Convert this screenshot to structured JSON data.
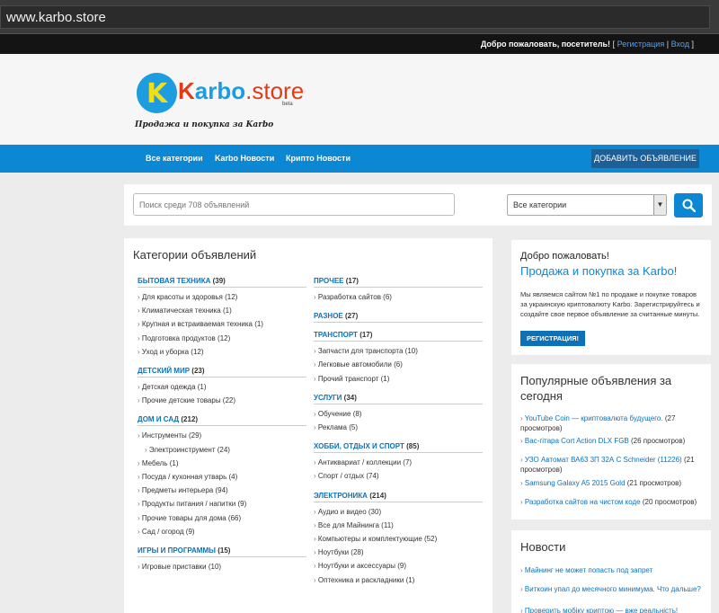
{
  "browser": {
    "url": "www.karbo.store"
  },
  "topbar": {
    "welcome": "Добро пожаловать, посетитель!",
    "open": "[",
    "register": "Регистрация",
    "sep": "|",
    "login": "Вход",
    "close": "]"
  },
  "brand": {
    "logo_letter": "K",
    "name_a": "K",
    "name_b": "arbo",
    "name_c": ".store",
    "beta": "beta",
    "tagline": "Продажа и покупка за Karbo"
  },
  "nav": {
    "items": [
      "Все категории",
      "Karbo Новости",
      "Крипто Новости"
    ],
    "add_button": "ДОБАВИТЬ ОБЪЯВЛЕНИЕ"
  },
  "search": {
    "placeholder": "Поиск среди 708 объявлений",
    "category_value": "Все категории"
  },
  "categories": {
    "title": "Категории объявлений",
    "left": [
      {
        "name": "БЫТОВАЯ ТЕХНИКА",
        "count": "(39)",
        "subs": [
          {
            "t": "Для красоты и здоровья (12)"
          },
          {
            "t": "Климатическая техника (1)"
          },
          {
            "t": "Крупная и встраиваемая техника (1)"
          },
          {
            "t": "Подготовка продуктов (12)"
          },
          {
            "t": "Уход и уборка (12)"
          }
        ]
      },
      {
        "name": "ДЕТСКИЙ МИР",
        "count": "(23)",
        "subs": [
          {
            "t": "Детская одежда (1)"
          },
          {
            "t": "Прочие детские товары (22)"
          }
        ]
      },
      {
        "name": "ДОМ И САД",
        "count": "(212)",
        "subs": [
          {
            "t": "Инструменты (29)"
          },
          {
            "t": "Электроинструмент (24)",
            "indent": true
          },
          {
            "t": "Мебель (1)"
          },
          {
            "t": "Посуда / кухонная утварь (4)"
          },
          {
            "t": "Предметы интерьера (94)"
          },
          {
            "t": "Продукты питания / напитки (9)"
          },
          {
            "t": "Прочие товары для дома (66)"
          },
          {
            "t": "Сад / огород (9)"
          }
        ]
      },
      {
        "name": "ИГРЫ И ПРОГРАММЫ",
        "count": "(15)",
        "subs": [
          {
            "t": "Игровые приставки (10)"
          }
        ]
      }
    ],
    "right": [
      {
        "name": "ПРОЧЕЕ",
        "count": "(17)",
        "subs": [
          {
            "t": "Разработка сайтов (6)"
          }
        ]
      },
      {
        "name": "РАЗНОЕ",
        "count": "(27)",
        "subs": []
      },
      {
        "name": "ТРАНСПОРТ",
        "count": "(17)",
        "subs": [
          {
            "t": "Запчасти для транспорта (10)"
          },
          {
            "t": "Легковые автомобили (6)"
          },
          {
            "t": "Прочий транспорт (1)"
          }
        ]
      },
      {
        "name": "УСЛУГИ",
        "count": "(34)",
        "subs": [
          {
            "t": "Обучение (8)"
          },
          {
            "t": "Реклама (5)"
          }
        ]
      },
      {
        "name": "ХОББИ, ОТДЫХ И СПОРТ",
        "count": "(85)",
        "subs": [
          {
            "t": "Антиквариат / коллекции (7)"
          },
          {
            "t": "Спорт / отдых (74)"
          }
        ]
      },
      {
        "name": "ЭЛЕКТРОНИКА",
        "count": "(214)",
        "subs": [
          {
            "t": "Аудио и видео (30)"
          },
          {
            "t": "Все для Майнинга (11)"
          },
          {
            "t": "Компьютеры и комплектующие (52)"
          },
          {
            "t": "Ноутбуки (28)"
          },
          {
            "t": "Ноутбуки и аксессуары (9)"
          },
          {
            "t": "Оптехника и раскладники (1)"
          }
        ]
      }
    ]
  },
  "welcome_box": {
    "hello": "Добро пожаловать!",
    "headline": "Продажа и покупка за Karbo!",
    "text": "Мы являемся сайтом №1 по продаже и покупке товаров за украинскую криптовалюту Karbo. Зарегистрируйтесь и создайте свое первое объявление за считанные минуты.",
    "button": "РЕГИСТРАЦИЯ!"
  },
  "popular": {
    "title": "Популярные объявления за сегодня",
    "items": [
      {
        "link": "YouTube Coin — криптовалюта будущего.",
        "views": "(27 просмотров)"
      },
      {
        "link": "Вас-гітара Cort Action DLX FGB",
        "views": "(26 просмотров)"
      },
      {
        "link": "УЗО Автомат ВА63 3П 32А С Schneider (11226)",
        "views": "(21 просмотров)"
      },
      {
        "link": "Samsung Galaxy A5 2015 Gold",
        "views": "(21 просмотров)"
      },
      {
        "link": "Разработка сайтов на чистом коде",
        "views": "(20 просмотров)"
      }
    ]
  },
  "news": {
    "title": "Новости",
    "items": [
      "Майнинг не может попасть под запрет",
      "Виткоин упал до месячного минимума. Что дальше?",
      "Проверить мобіку криптою — вже реальність!"
    ]
  },
  "colors": {
    "primary": "#0c87d3",
    "link": "#0c72b8",
    "logo_yellow": "#f2dd1a",
    "logo_red": "#e33b17"
  }
}
